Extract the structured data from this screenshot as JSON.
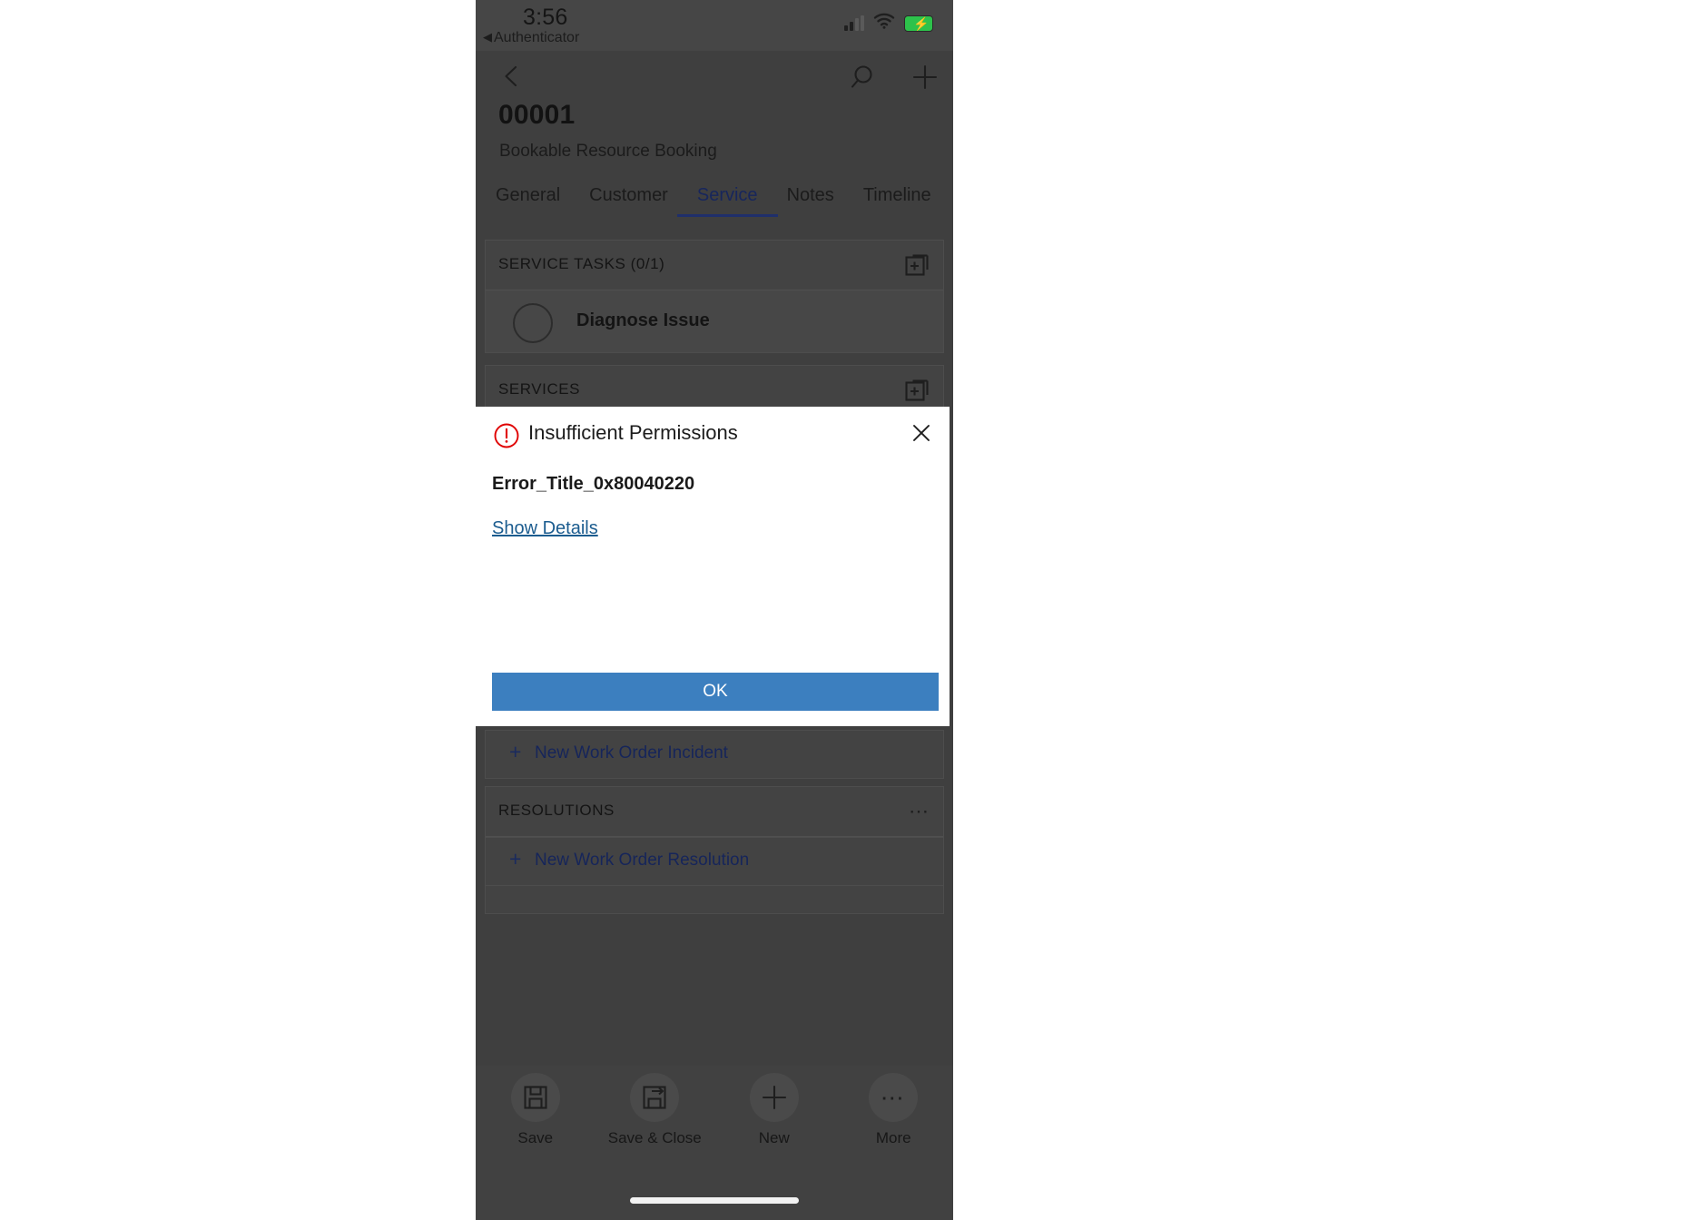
{
  "theme": {
    "dialog_bg": "#ffffff",
    "primary_button": "#3c7fbf",
    "link_color": "#1b5c8f",
    "accent_tab": "#1f2f6b",
    "error_red": "#e00000",
    "battery_green": "#2dc24b",
    "app_backdrop": "#3f3f3f"
  },
  "status_bar": {
    "time": "3:56",
    "back_app_label": "Authenticator",
    "back_triangle": "◀",
    "icons": {
      "signal": "signal-bars-icon",
      "wifi": "wifi-icon",
      "battery": "battery-charging-icon"
    }
  },
  "nav_bar": {
    "back_icon": "chevron-left-icon",
    "search_icon": "search-icon",
    "add_icon": "plus-icon"
  },
  "record": {
    "id": "00001",
    "entity_type": "Bookable Resource Booking"
  },
  "tabs": [
    {
      "label": "General",
      "active": false
    },
    {
      "label": "Customer",
      "active": false
    },
    {
      "label": "Service",
      "active": true
    },
    {
      "label": "Notes",
      "active": false
    },
    {
      "label": "Timeline",
      "active": false
    }
  ],
  "sections": {
    "service_tasks": {
      "header": "SERVICE TASKS (0/1)",
      "action_icon": "add-existing-record-icon",
      "tasks": [
        {
          "name": "Diagnose Issue",
          "completed": false,
          "checkbox_icon": "circle-unchecked-icon"
        }
      ]
    },
    "services": {
      "header": "SERVICES",
      "action_icon": "add-existing-record-icon"
    },
    "incidents": {
      "new_link": "New Work Order Incident",
      "plus_icon": "plus-icon"
    },
    "resolutions": {
      "header": "RESOLUTIONS",
      "overflow_icon": "ellipsis-icon",
      "new_link": "New Work Order Resolution",
      "plus_icon": "plus-icon"
    }
  },
  "dialog": {
    "alert_icon": "error-circle-exclamation-icon",
    "title": "Insufficient Permissions",
    "close_icon": "close-icon",
    "error_code": "Error_Title_0x80040220",
    "show_details_label": "Show Details",
    "ok_label": "OK"
  },
  "command_bar": {
    "items": [
      {
        "label": "Save",
        "icon": "save-floppy-icon"
      },
      {
        "label": "Save & Close",
        "icon": "save-and-close-icon"
      },
      {
        "label": "New",
        "icon": "plus-icon"
      },
      {
        "label": "More",
        "icon": "ellipsis-icon"
      }
    ]
  }
}
